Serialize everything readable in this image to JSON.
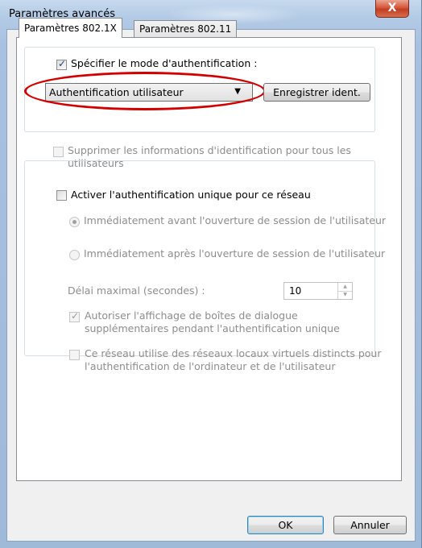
{
  "window": {
    "title": "Paramètres avancés",
    "close_glyph": "X"
  },
  "tabs": [
    {
      "label": "Paramètres 802.1X",
      "active": true
    },
    {
      "label": "Paramètres 802.11",
      "active": false
    }
  ],
  "auth_group": {
    "specify_mode_label": "Spécifier le mode d'authentification :",
    "specify_mode_checked": true,
    "mode_select_value": "Authentification utilisateur",
    "save_credentials_label": "Enregistrer ident.",
    "delete_credentials_label": "Supprimer les informations d'identification pour tous les utilisateurs",
    "delete_credentials_checked": false
  },
  "sso_group": {
    "enable_sso_label": "Activer l'authentification unique pour ce réseau",
    "enable_sso_checked": false,
    "radio_before_label": "Immédiatement avant l'ouverture de session de l'utilisateur",
    "radio_before_selected": true,
    "radio_after_label": "Immédiatement après l'ouverture de session de l'utilisateur",
    "radio_after_selected": false,
    "delay_label": "Délai maximal (secondes) :",
    "delay_value": "10",
    "allow_dialogs_label": "Autoriser l'affichage de boîtes de dialogue supplémentaires pendant l'authentification unique",
    "allow_dialogs_checked": true,
    "vlan_label": "Ce réseau utilise des réseaux locaux virtuels distincts pour l'authentification de l'ordinateur et de l'utilisateur",
    "vlan_checked": false
  },
  "footer": {
    "ok_label": "OK",
    "cancel_label": "Annuler"
  },
  "colors": {
    "highlight_ellipse": "#d40000",
    "close_button": "#c23d22",
    "disabled_text": "#8d8d8d"
  }
}
